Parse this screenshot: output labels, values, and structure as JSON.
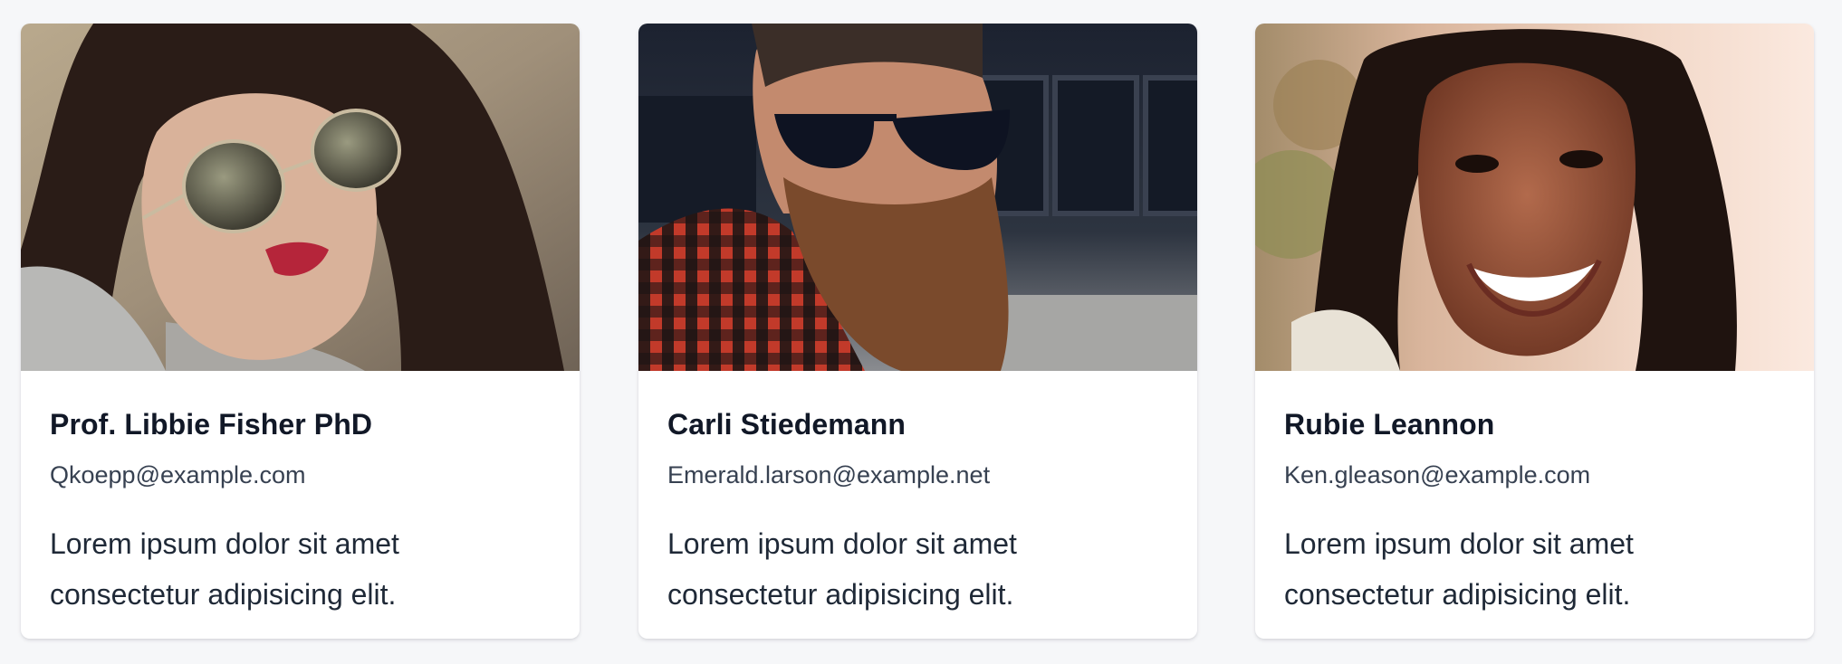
{
  "cards": [
    {
      "name": "Prof. Libbie Fisher PhD",
      "email": "Qkoepp@example.com",
      "description": "Lorem ipsum dolor sit amet consectetur adipisicing elit.",
      "photo_icon": "portrait-woman-aviator-sunglasses"
    },
    {
      "name": "Carli Stiedemann",
      "email": "Emerald.larson@example.net",
      "description": "Lorem ipsum dolor sit amet consectetur adipisicing elit.",
      "photo_icon": "portrait-bearded-man-sunglasses"
    },
    {
      "name": "Rubie Leannon",
      "email": "Ken.gleason@example.com",
      "description": "Lorem ipsum dolor sit amet consectetur adipisicing elit.",
      "photo_icon": "portrait-smiling-woman-braids"
    }
  ],
  "colors": {
    "background": "#f6f7f9",
    "card": "#ffffff",
    "name_text": "#111827",
    "email_text": "#374151",
    "body_text": "#1f2937"
  }
}
